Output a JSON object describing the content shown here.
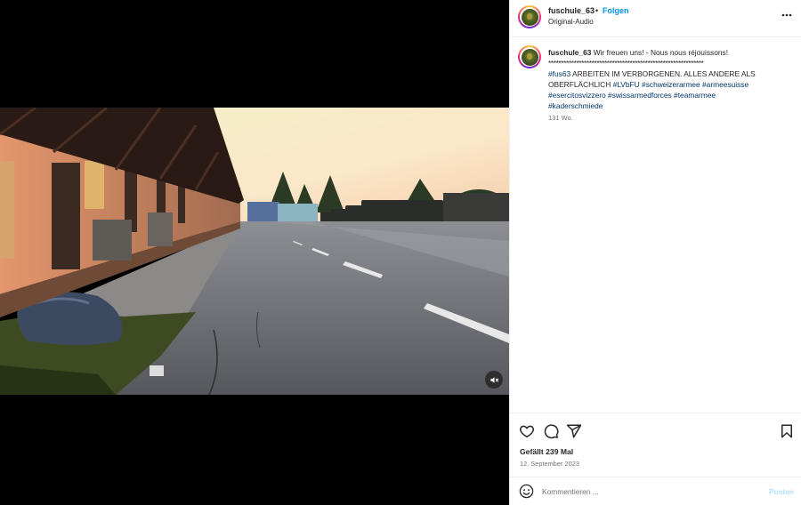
{
  "post": {
    "username": "fuschule_63",
    "separator": "•",
    "follow_label": "Folgen",
    "audio_label": "Original-Audio",
    "more_icon": "more-horizontal-icon"
  },
  "media": {
    "mute_icon": "muted-speaker-icon"
  },
  "caption": {
    "username": "fuschule_63",
    "text_intro": "Wir freuen uns! - Nous nous réjouissons!",
    "stars": "*************************************************************",
    "tag_fus63": "#fus63",
    "text_main": "ARBEITEN IM VERBORGENEN. ALLES ANDERE ALS OBERFLÄCHLICH",
    "tag_lvbfu": "#LVbFU",
    "tag_schweizerarmee": "#schweizerarmee",
    "tag_armeesuisse": "#armeesuisse",
    "tag_esercito": "#esercitosvizzero",
    "tag_swissarmed": "#swissarmedforces",
    "tag_teamarmee": "#teamarmee",
    "tag_kader": "#kaderschmiede",
    "time": "131 Wo."
  },
  "actions": {
    "like_icon": "heart-icon",
    "comment_icon": "comment-bubble-icon",
    "share_icon": "paper-plane-icon",
    "save_icon": "bookmark-icon",
    "likes_text": "Gefällt 239 Mal",
    "date_text": "12. September 2023"
  },
  "comment_box": {
    "emoji_icon": "emoji-smiley-icon",
    "placeholder": "Kommentieren ...",
    "post_label": "Posten"
  },
  "colors": {
    "link": "#0095f6",
    "hashtag": "#00376b",
    "muted": "#737373",
    "post_disabled": "#b2dffc"
  }
}
